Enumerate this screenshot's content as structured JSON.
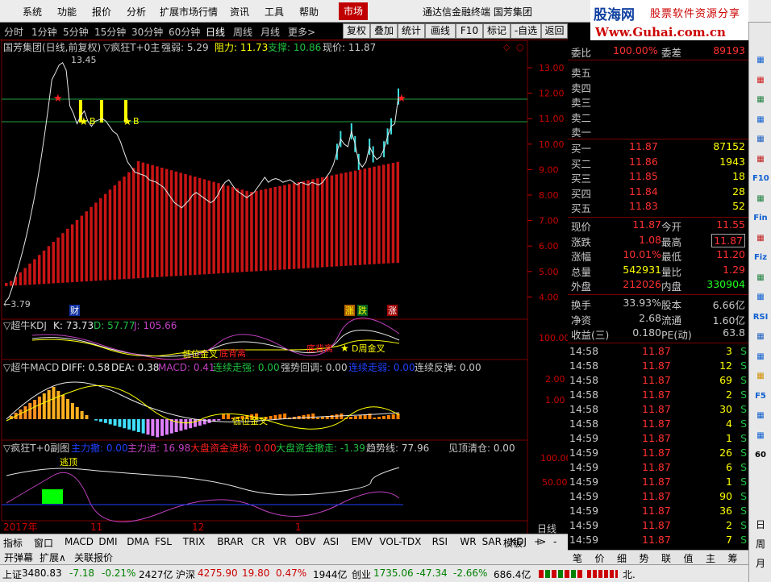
{
  "menu": {
    "items": [
      "系统",
      "功能",
      "报价",
      "分析",
      "扩展市场行情",
      "资讯",
      "工具",
      "帮助"
    ],
    "market": "市场",
    "title": "通达信金融终端 国芳集团"
  },
  "logo": {
    "brand": "股海网",
    "slogan": "股票软件资源分享",
    "url": "Www.Guhai.com.cn"
  },
  "periods": [
    "分时",
    "1分钟",
    "5分钟",
    "15分钟",
    "30分钟",
    "60分钟",
    "日线",
    "周线",
    "月线",
    "更多>"
  ],
  "right_buttons": [
    "复权",
    "叠加",
    "统计",
    "画线",
    "F10",
    "标记",
    "-自选",
    "返回"
  ],
  "main_chart": {
    "header": {
      "title": "国芳集团(日线,前复权)",
      "indicator": "▽疯狂T+0主",
      "strength": "强弱: 5.29",
      "resistance": "阻力: 11.73",
      "support": "支撑: 10.86",
      "price": "现价: 11.87"
    },
    "y_ticks": [
      "13.00",
      "12.00",
      "11.00",
      "10.00",
      "9.00",
      "8.00",
      "7.00",
      "6.00",
      "5.00",
      "4.00"
    ],
    "high_label": "13.45",
    "low_label": "←3.79",
    "markers": {
      "b1": "B",
      "b2": "B",
      "cai": "财",
      "zhang": "涨",
      "die": "跌",
      "zhang2": "涨"
    },
    "close_series": [
      3.79,
      3.95,
      4.35,
      4.83,
      5.31,
      5.84,
      6.42,
      7.06,
      7.77,
      8.55,
      9.41,
      10.35,
      11.38,
      12.52,
      12.8,
      13.1,
      13.2,
      12.9,
      11.5,
      11.2,
      10.8,
      11.1,
      11.3,
      10.9,
      10.7,
      10.9,
      10.95,
      11.0,
      10.9,
      10.7,
      10.5,
      10.4,
      10.1,
      9.7,
      9.3,
      9.1,
      8.9,
      8.85,
      8.8,
      8.75,
      8.6,
      8.55,
      8.5,
      8.4,
      8.3,
      8.1,
      7.9,
      7.7,
      7.6,
      7.5,
      7.65,
      7.8,
      8.0,
      8.1,
      8.0,
      7.9,
      7.8,
      7.7,
      7.8,
      8.0,
      8.3,
      8.5,
      8.6,
      8.4,
      8.2,
      8.1,
      8.0,
      7.9,
      8.0,
      8.1,
      8.3,
      8.5,
      8.7,
      8.5,
      8.6,
      8.65,
      8.6,
      8.5,
      8.55,
      8.6,
      8.5,
      8.4,
      8.5,
      8.45,
      8.4,
      8.5,
      8.45,
      8.4,
      8.5,
      8.7,
      8.9,
      9.2,
      9.7,
      10.2,
      10.0,
      9.9,
      10.5,
      10.0,
      9.3,
      9.1,
      9.3,
      9.9,
      9.6,
      9.4,
      9.5,
      9.8,
      10.3,
      10.7,
      10.8,
      11.87
    ]
  },
  "kdj": {
    "label": "▽超牛KDJ",
    "k": "K: 73.73",
    "d": "D: 57.77",
    "j": "J: 105.66",
    "tick": "100.00",
    "ann1": "低位金叉",
    "ann2": "底背离",
    "ann3": "底背离",
    "ann4": "D周金叉"
  },
  "macd": {
    "label": "▽超牛MACD",
    "diff": "DIFF: 0.58",
    "dea": "DEA: 0.38",
    "macd": "MACD: 0.41",
    "s1": "连续走强: 0.00",
    "s2": "强势回调: 0.00",
    "s3": "连续走弱: 0.00",
    "s4": "连续反弹: 0.00",
    "ticks": [
      "2.00",
      "1.00"
    ],
    "ann": "低位金叉"
  },
  "t0": {
    "label": "▽疯狂T+0副图",
    "a": "主力撤: 0.00",
    "b": "主力进: 16.98",
    "c": "大盘资金进场: 0.00",
    "d": "大盘资金撤走: -1.39",
    "e": "趋势线: 77.96",
    "f": "见顶清仓: 0.00",
    "ticks": [
      "100.00",
      "50.00"
    ],
    "ann": "逃顶"
  },
  "time_axis": {
    "labels": [
      "2017年",
      "11",
      "12",
      "1"
    ],
    "period": "日线"
  },
  "bottom_tabs": [
    "指标",
    "窗口",
    "MACD",
    "DMI",
    "DMA",
    "FSL",
    "TRIX",
    "BRAR",
    "CR",
    "VR",
    "OBV",
    "ASI",
    "EMV",
    "VOL-TDX",
    "RSI",
    "WR",
    "SAR",
    "KDJ",
    ">",
    "模板",
    "+",
    "-"
  ],
  "bottom_tabs2": [
    "开弹幕",
    "扩展∧",
    "关联报价"
  ],
  "quote": {
    "weibi_label": "委比",
    "weibi": "100.00%",
    "weicha_label": "委差",
    "weicha": "89193",
    "sell": [
      {
        "label": "卖五"
      },
      {
        "label": "卖四"
      },
      {
        "label": "卖三"
      },
      {
        "label": "卖二"
      },
      {
        "label": "卖一"
      }
    ],
    "buy": [
      {
        "label": "买一",
        "price": "11.87",
        "vol": "87152"
      },
      {
        "label": "买二",
        "price": "11.86",
        "vol": "1943"
      },
      {
        "label": "买三",
        "price": "11.85",
        "vol": "18"
      },
      {
        "label": "买四",
        "price": "11.84",
        "vol": "28"
      },
      {
        "label": "买五",
        "price": "11.83",
        "vol": "52"
      }
    ],
    "stats": [
      {
        "l1": "现价",
        "v1": "11.87",
        "l2": "今开",
        "v2": "11.55"
      },
      {
        "l1": "涨跌",
        "v1": "1.08",
        "l2": "最高",
        "v2": "11.87"
      },
      {
        "l1": "涨幅",
        "v1": "10.01%",
        "l2": "最低",
        "v2": "11.20"
      },
      {
        "l1": "总量",
        "v1": "542931",
        "l2": "量比",
        "v2": "1.29"
      },
      {
        "l1": "外盘",
        "v1": "212026",
        "l2": "内盘",
        "v2": "330904"
      }
    ],
    "stats2": [
      {
        "l1": "换手",
        "v1": "33.93%",
        "l2": "股本",
        "v2": "6.66亿"
      },
      {
        "l1": "净资",
        "v1": "2.68",
        "l2": "流通",
        "v2": "1.60亿"
      },
      {
        "l1": "收益(三)",
        "v1": "0.180",
        "l2": "PE(动)",
        "v2": "63.8"
      }
    ],
    "ticks": [
      {
        "t": "14:58",
        "p": "11.87",
        "v": "3",
        "s": "S"
      },
      {
        "t": "14:58",
        "p": "11.87",
        "v": "12",
        "s": "S"
      },
      {
        "t": "14:58",
        "p": "11.87",
        "v": "69",
        "s": "S"
      },
      {
        "t": "14:58",
        "p": "11.87",
        "v": "2",
        "s": "S"
      },
      {
        "t": "14:58",
        "p": "11.87",
        "v": "30",
        "s": "S"
      },
      {
        "t": "14:58",
        "p": "11.87",
        "v": "4",
        "s": "S"
      },
      {
        "t": "14:59",
        "p": "11.87",
        "v": "1",
        "s": "S"
      },
      {
        "t": "14:59",
        "p": "11.87",
        "v": "26",
        "s": "S"
      },
      {
        "t": "14:59",
        "p": "11.87",
        "v": "6",
        "s": "S"
      },
      {
        "t": "14:59",
        "p": "11.87",
        "v": "1",
        "s": "S"
      },
      {
        "t": "14:59",
        "p": "11.87",
        "v": "90",
        "s": "S"
      },
      {
        "t": "14:59",
        "p": "11.87",
        "v": "36",
        "s": "S"
      },
      {
        "t": "14:59",
        "p": "11.87",
        "v": "2",
        "s": "S"
      },
      {
        "t": "14:59",
        "p": "11.87",
        "v": "7",
        "s": "S"
      }
    ],
    "bottom": [
      "笔",
      "价",
      "细",
      "势",
      "联",
      "值",
      "主",
      "筹"
    ]
  },
  "status": {
    "sh_label": "上证",
    "sh": "3480.83",
    "sh_chg": "-7.18",
    "sh_pct": "-0.21%",
    "sh_amt": "2427亿",
    "sz_label": "沪深",
    "sz": "4275.90",
    "sz_chg": "19.80",
    "sz_pct": "0.47%",
    "sz_amt": "1944亿",
    "cy_label": "创业",
    "cy": "1735.06",
    "cy_chg": "-47.34",
    "cy_pct": "-2.66%",
    "cy_amt": "686.4亿",
    "tail": "北."
  },
  "sidebar": {
    "icons": [
      "chart-icon",
      "list-icon",
      "kline-icon",
      "table-icon",
      "line-icon",
      "bars-icon",
      "f10-icon",
      "grid-icon",
      "fin-icon",
      "mag-icon",
      "fiz-icon",
      "search-icon",
      "table2-icon",
      "rsi-icon",
      "scale-icon",
      "move-icon",
      "pen-icon",
      "f5-icon",
      "export-icon",
      "circle-icon",
      "num-icon"
    ],
    "labels": [
      "",
      "",
      "",
      "",
      "",
      "",
      "F10",
      "",
      "Fin",
      "",
      "Fiz",
      "",
      "",
      "RSI",
      "",
      "",
      "",
      "F5",
      "",
      "",
      "60"
    ],
    "day": [
      "日",
      "周",
      "月"
    ]
  }
}
